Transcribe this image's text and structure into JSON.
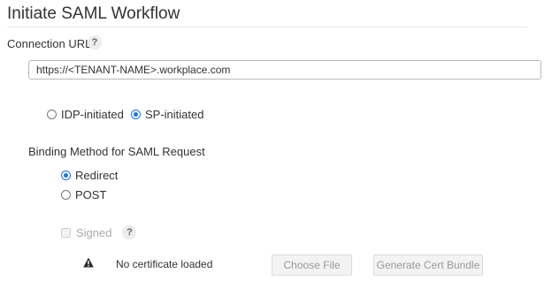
{
  "page": {
    "title": "Initiate SAML Workflow"
  },
  "connection": {
    "label": "Connection URL",
    "help": "?",
    "url_value": "https://<TENANT-NAME>.workplace.com"
  },
  "initiation": {
    "options": [
      {
        "label": "IDP-initiated",
        "checked": false
      },
      {
        "label": "SP-initiated",
        "checked": true
      }
    ]
  },
  "binding": {
    "label": "Binding Method for SAML Request",
    "options": [
      {
        "label": "Redirect",
        "checked": true
      },
      {
        "label": "POST",
        "checked": false
      }
    ]
  },
  "signing": {
    "label": "Signed",
    "checked": false,
    "disabled": true,
    "help": "?"
  },
  "certificate": {
    "status": "No certificate loaded",
    "choose_file_label": "Choose File",
    "generate_label": "Generate Cert Bundle"
  },
  "icons": {
    "warning": "warning-triangle-icon",
    "help": "question-mark-icon"
  },
  "colors": {
    "accent": "#1a73e8",
    "disabled_text": "#aaaaaa"
  }
}
